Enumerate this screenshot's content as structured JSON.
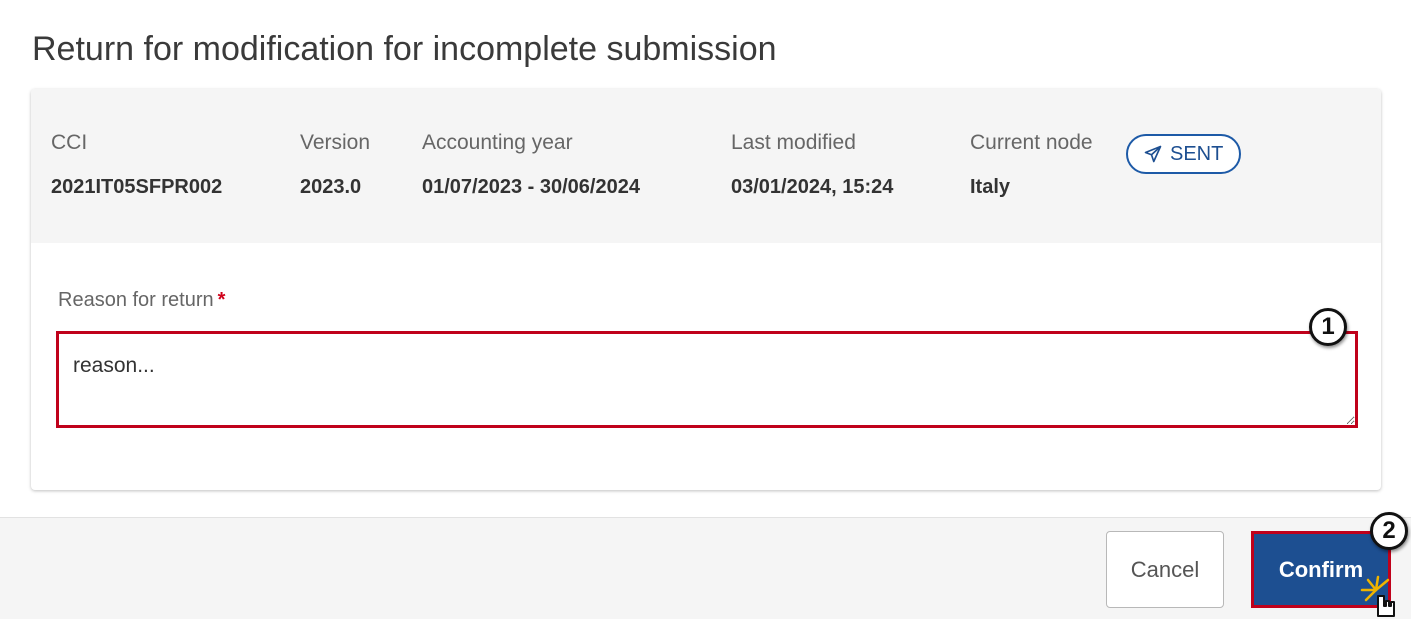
{
  "dialog": {
    "title": "Return for modification for incomplete submission"
  },
  "info": {
    "cci": {
      "label": "CCI",
      "value": "2021IT05SFPR002"
    },
    "version": {
      "label": "Version",
      "value": "2023.0"
    },
    "accounting_year": {
      "label": "Accounting year",
      "value": "01/07/2023 - 30/06/2024"
    },
    "last_modified": {
      "label": "Last modified",
      "value": "03/01/2024, 15:24"
    },
    "current_node": {
      "label": "Current node",
      "value": "Italy"
    },
    "status_badge": {
      "label": "SENT",
      "icon": "paper-plane-icon"
    }
  },
  "form": {
    "reason_label": "Reason for return",
    "required_marker": "*",
    "reason_value": "reason..."
  },
  "buttons": {
    "cancel_label": "Cancel",
    "confirm_label": "Confirm"
  },
  "callouts": {
    "one": "1",
    "two": "2"
  },
  "colors": {
    "primary": "#1d4f91",
    "highlight": "#c0011b",
    "required": "#d0021b"
  }
}
